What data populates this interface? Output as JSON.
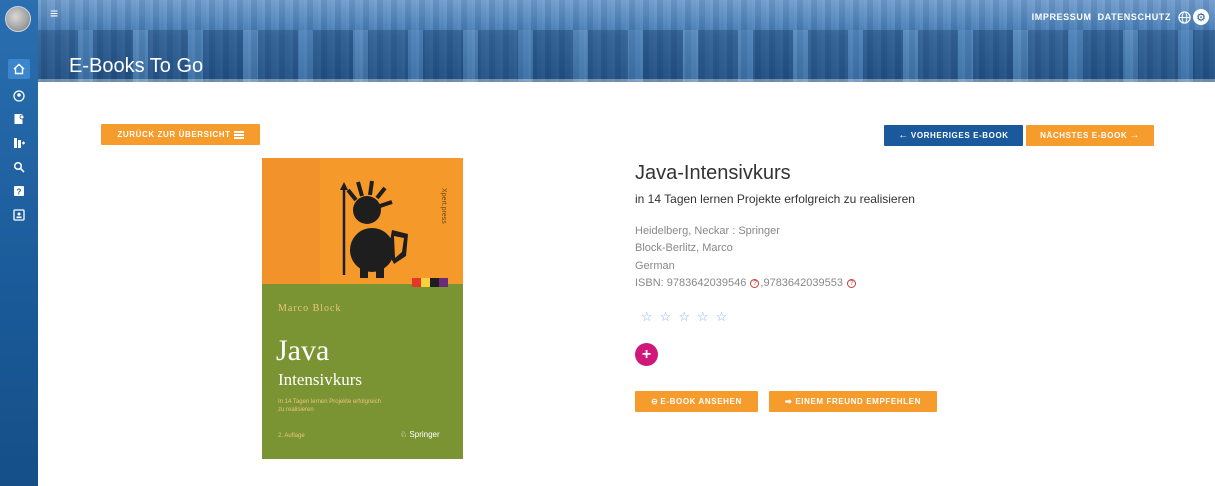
{
  "header": {
    "title": "E-Books To Go",
    "links": [
      "IMPRESSUM",
      "DATENSCHUTZ"
    ]
  },
  "sidebar": {
    "icons": [
      "home-icon",
      "user-circle-icon",
      "bookmark-user-icon",
      "book-plus-icon",
      "search-icon",
      "help-icon",
      "id-card-icon"
    ]
  },
  "nav": {
    "back_label": "ZURÜCK ZUR ÜBERSICHT",
    "prev_label": "VORHERIGES E-BOOK",
    "next_label": "NÄCHSTES E-BOOK"
  },
  "cover": {
    "author": "Marco Block",
    "title": "Java",
    "subtitle": "Intensivkurs",
    "tagline": "In 14 Tagen lernen Projekte erfolgreich zu realisieren",
    "edition": "2. Auflage",
    "publisher": "Springer",
    "series": "Xpert.press"
  },
  "book": {
    "title": "Java-Intensivkurs",
    "subtitle": "in 14 Tagen lernen Projekte erfolgreich zu realisieren",
    "publisher": "Heidelberg, Neckar : Springer",
    "author": "Block-Berlitz, Marco",
    "language": "German",
    "isbn_label": "ISBN:",
    "isbn1": "9783642039546",
    "isbn2": "9783642039553",
    "rating": 0,
    "rating_max": 5
  },
  "actions": {
    "view_label": "E-BOOK ANSEHEN",
    "recommend_label": "EINEM FREUND EMPFEHLEN"
  },
  "colors": {
    "accent_orange": "#f59c2d",
    "accent_blue": "#1a5a9c",
    "plus_magenta": "#d0187b"
  }
}
